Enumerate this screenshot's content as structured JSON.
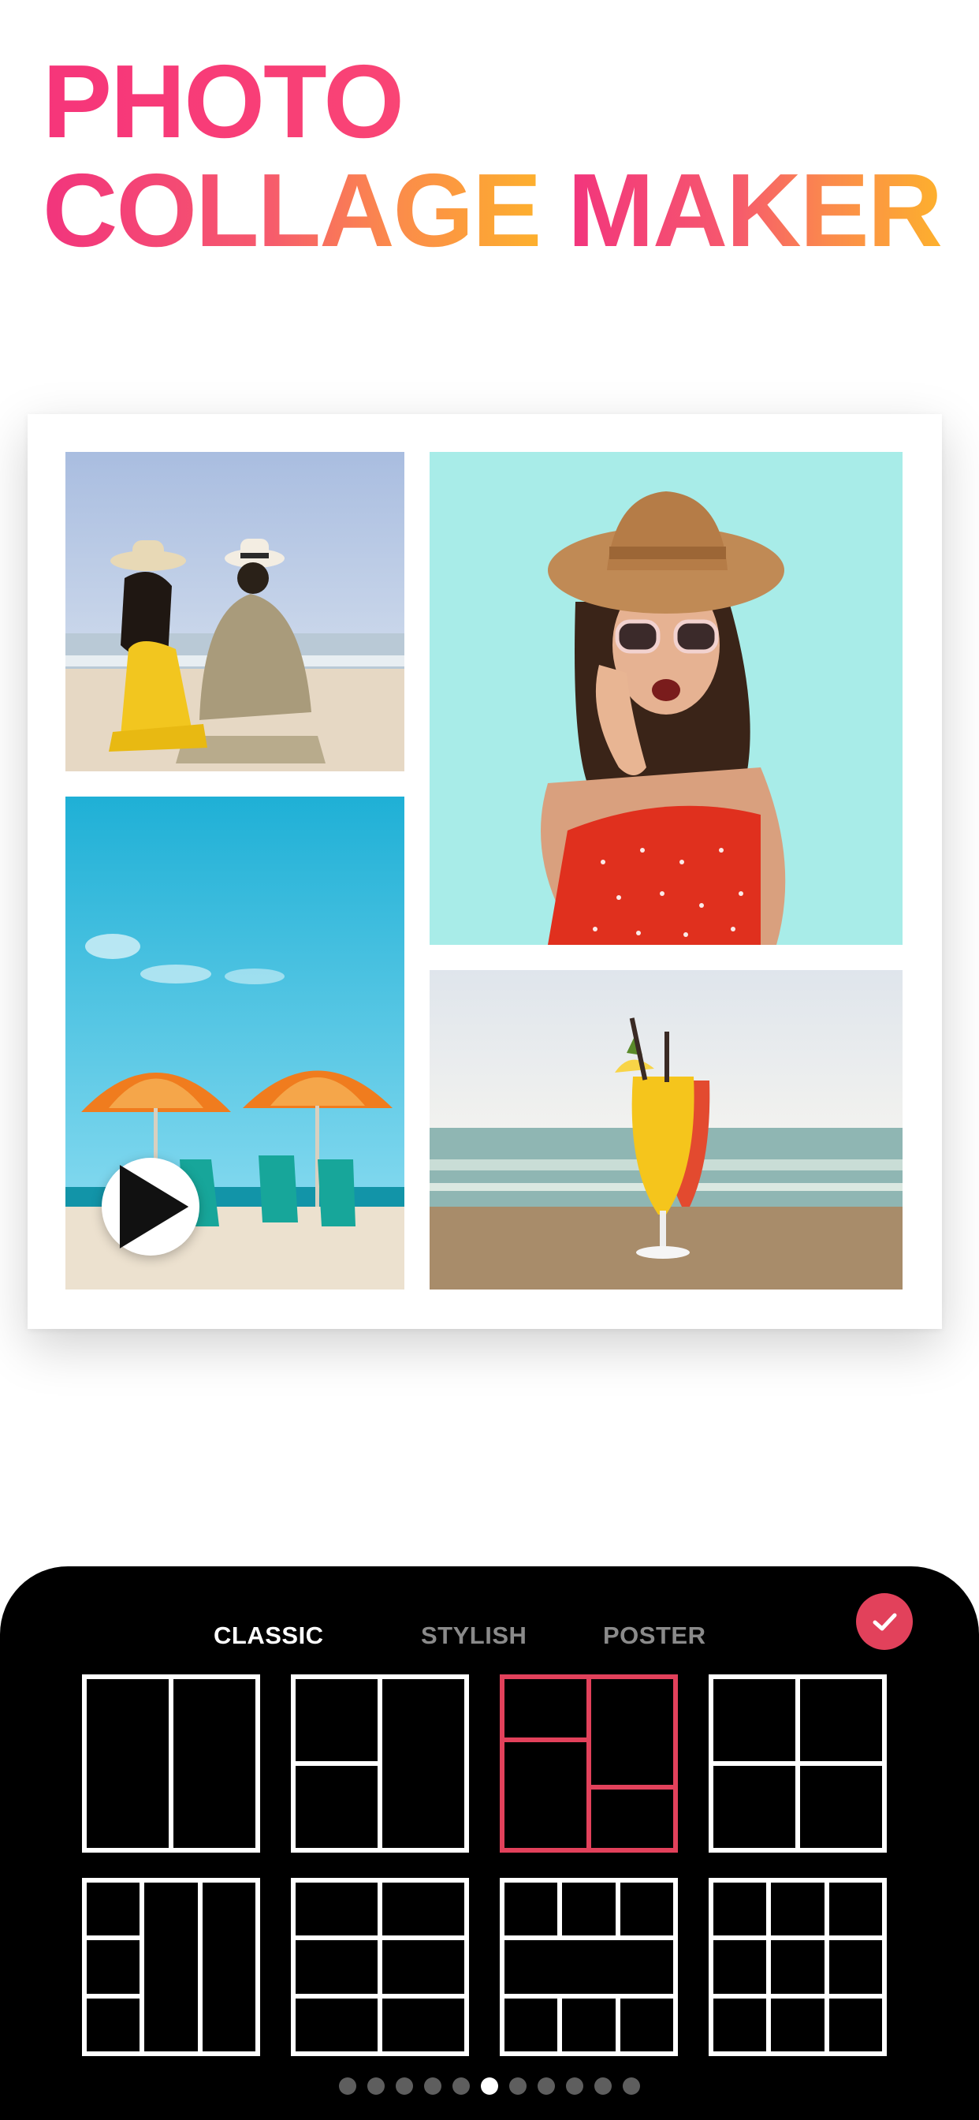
{
  "headline": {
    "line1": "PHOTO",
    "line2_part1": "COLLAGE",
    "line2_part2": "MAKER"
  },
  "collage": {
    "photos": [
      {
        "name": "couple-beach-photo"
      },
      {
        "name": "woman-red-dress-photo"
      },
      {
        "name": "beach-umbrellas-video",
        "badge": "play-icon"
      },
      {
        "name": "cocktail-beach-photo"
      }
    ]
  },
  "panel": {
    "tabs": [
      {
        "label": "CLASSIC",
        "active": true
      },
      {
        "label": "STYLISH",
        "active": false
      },
      {
        "label": "POSTER",
        "active": false
      }
    ],
    "confirm_icon": "checkmark-icon",
    "selected_layout_index": 2,
    "page_count": 11,
    "active_page": 5
  },
  "colors": {
    "accent": "#e2415b",
    "panel_bg": "#000000",
    "headline_pink": "#f6357a",
    "headline_orange": "#fdb02d"
  }
}
